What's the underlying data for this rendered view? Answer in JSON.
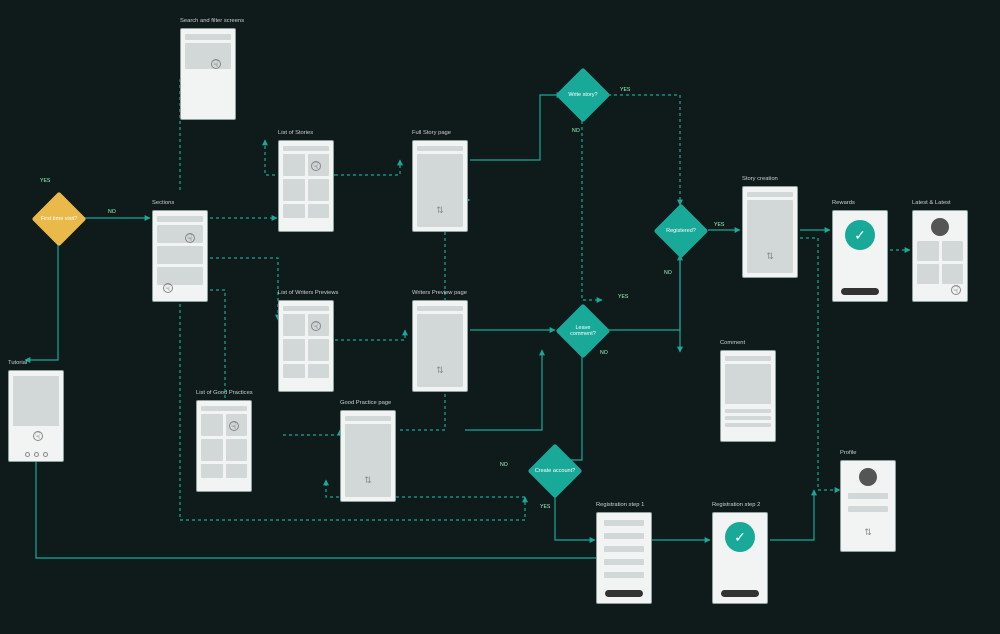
{
  "screens": {
    "tutorial": "Tutorial",
    "search_filter": "Search and filter screens",
    "sections": "Sections",
    "list_stories": "List of Stories",
    "list_writers": "List of Writers Previews",
    "list_good": "List of Good Practices",
    "full_story": "Full Story page",
    "writers_preview": "Writers Preview page",
    "good_practice": "Good Practice page",
    "story_creation": "Story creation",
    "rewards": "Rewards",
    "latest_latest": "Latest & Latest",
    "comment": "Comment",
    "reg1": "Registration step 1",
    "reg2": "Registration step 2",
    "profile": "Profile"
  },
  "decisions": {
    "first_visit": "First time visit?",
    "write_story": "Write story?",
    "registered": "Registered?",
    "leave_comment": "Leave comment?",
    "create_account": "Create account?"
  },
  "edges": {
    "yes": "YES",
    "no": "NO"
  },
  "colors": {
    "teal": "#18a999",
    "amber": "#e9b949"
  }
}
